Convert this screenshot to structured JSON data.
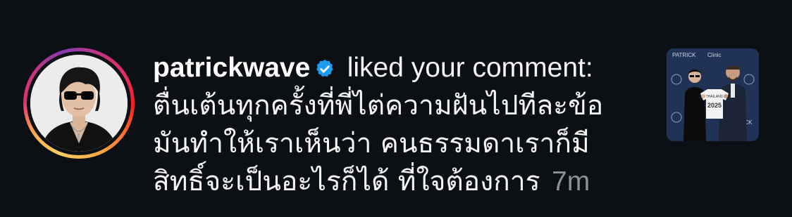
{
  "notification": {
    "username": "patrickwave",
    "action": "liked your comment:",
    "comment_lines": [
      "ตื่นเต้นทุกครั้งที่พี่ไต่ความฝันไปทีละข้อ",
      "มันทำให้เราเห็นว่า คนธรรมดาเราก็มี",
      "สิทธิ์จะเป็นอะไรก็ได้ ที่ใจต้องการ"
    ],
    "time": "7m",
    "verified_icon": "verified-badge-icon"
  },
  "thumbnail": {
    "banner_text_1": "PATRICK",
    "banner_text_2": "Clinic",
    "jersey_name": "THAILAND",
    "jersey_number": "2025"
  },
  "colors": {
    "background": "#0c0f14",
    "text": "#f5f5f5",
    "muted": "#8e9096",
    "verified_blue": "#1d9bf0"
  }
}
